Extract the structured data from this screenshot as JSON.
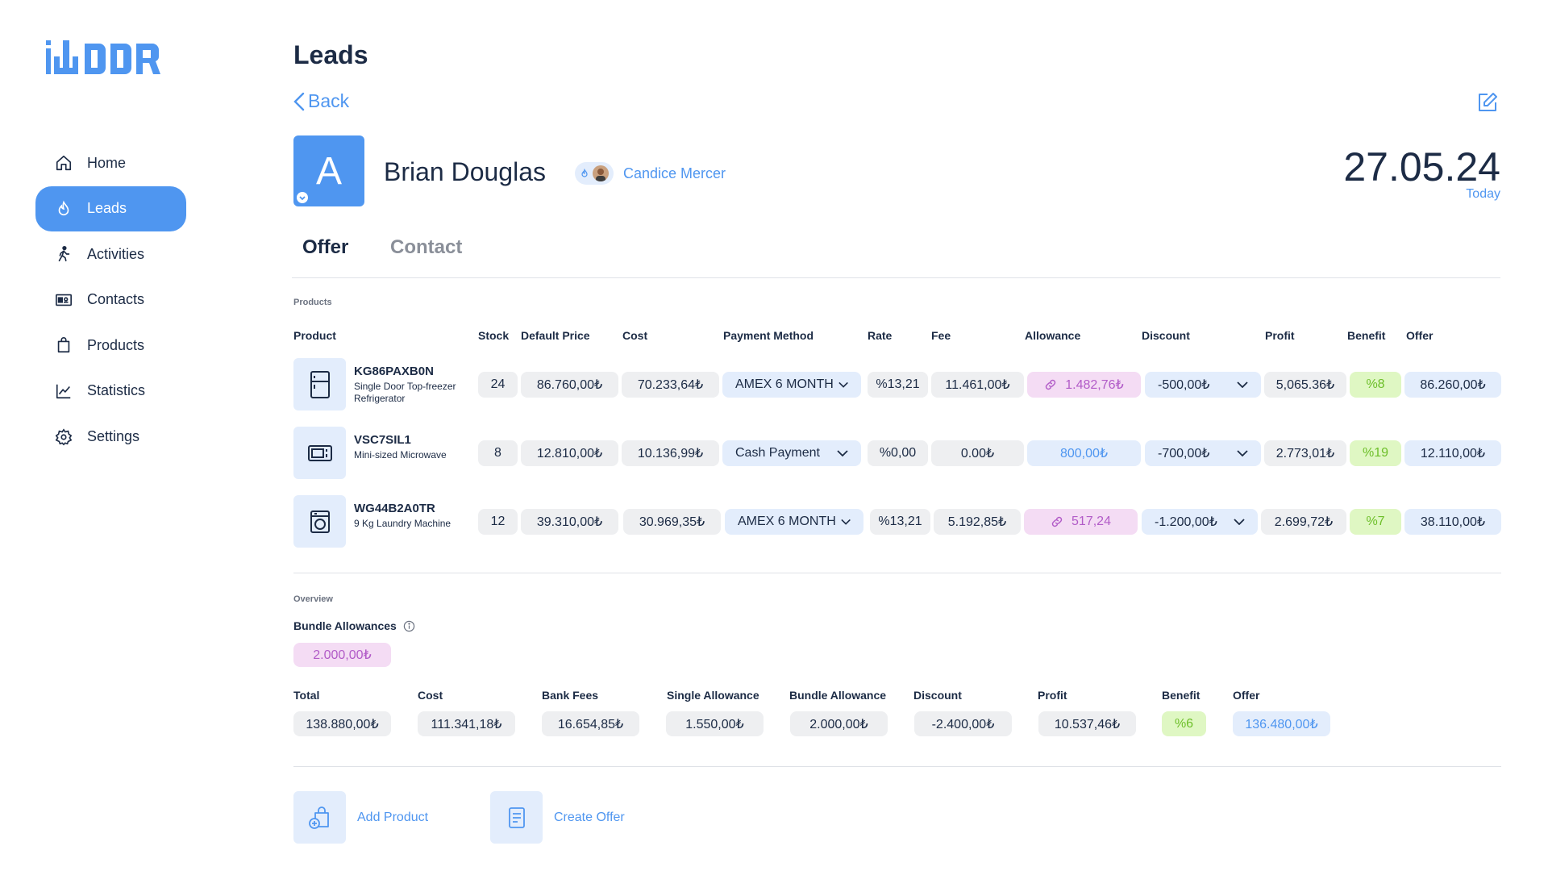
{
  "brand": {
    "logo_text": "iWDDR",
    "accent": "#4f96f0"
  },
  "sidebar": {
    "items": [
      {
        "label": "Home",
        "icon": "home-icon",
        "active": false
      },
      {
        "label": "Leads",
        "icon": "flame-icon",
        "active": true
      },
      {
        "label": "Activities",
        "icon": "walking-icon",
        "active": false
      },
      {
        "label": "Contacts",
        "icon": "contact-card-icon",
        "active": false
      },
      {
        "label": "Products",
        "icon": "bag-icon",
        "active": false
      },
      {
        "label": "Statistics",
        "icon": "chart-line-icon",
        "active": false
      },
      {
        "label": "Settings",
        "icon": "gear-icon",
        "active": false
      }
    ]
  },
  "header": {
    "title": "Leads",
    "back_label": "Back",
    "lead": {
      "initial": "A",
      "name": "Brian Douglas",
      "owner": "Candice Mercer"
    },
    "date": "27.05.24",
    "date_sub": "Today"
  },
  "tabs": [
    {
      "label": "Offer",
      "active": true
    },
    {
      "label": "Contact",
      "active": false
    }
  ],
  "products": {
    "section_label": "Products",
    "columns": [
      "Product",
      "Stock",
      "Default Price",
      "Cost",
      "Payment Method",
      "Rate",
      "Fee",
      "Allowance",
      "Discount",
      "Profit",
      "Benefit",
      "Offer"
    ],
    "rows": [
      {
        "icon": "fridge-icon",
        "code": "KG86PAXB0N",
        "desc": "Single Door Top-freezer Refrigerator",
        "stock": "24",
        "default_price": "86.760,00₺",
        "cost": "70.233,64₺",
        "payment": "AMEX 6 MONTH",
        "rate": "%13,21",
        "fee": "11.461,00₺",
        "allowance": "1.482,76₺",
        "allowance_type": "linked",
        "discount": "-500,00₺",
        "profit": "5,065.36₺",
        "benefit": "%8",
        "offer": "86.260,00₺"
      },
      {
        "icon": "microwave-icon",
        "code": "VSC7SIL1",
        "desc": "Mini-sized Microwave",
        "stock": "8",
        "default_price": "12.810,00₺",
        "cost": "10.136,99₺",
        "payment": "Cash Payment",
        "rate": "%0,00",
        "fee": "0.00₺",
        "allowance": "800,00₺",
        "allowance_type": "plain",
        "discount": "-700,00₺",
        "profit": "2.773,01₺",
        "benefit": "%19",
        "offer": "12.110,00₺"
      },
      {
        "icon": "washing-machine-icon",
        "code": "WG44B2A0TR",
        "desc": "9 Kg Laundry Machine",
        "stock": "12",
        "default_price": "39.310,00₺",
        "cost": "30.969,35₺",
        "payment": "AMEX 6 MONTH",
        "rate": "%13,21",
        "fee": "5.192,85₺",
        "allowance": "517,24",
        "allowance_type": "linked",
        "discount": "-1.200,00₺",
        "profit": "2.699,72₺",
        "benefit": "%7",
        "offer": "38.110,00₺"
      }
    ]
  },
  "overview": {
    "section_label": "Overview",
    "bundle_label": "Bundle Allowances",
    "bundle_value": "2.000,00₺",
    "summary": [
      {
        "label": "Total",
        "value": "138.880,00₺"
      },
      {
        "label": "Cost",
        "value": "111.341,18₺"
      },
      {
        "label": "Bank Fees",
        "value": "16.654,85₺"
      },
      {
        "label": "Single Allowance",
        "value": "1.550,00₺"
      },
      {
        "label": "Bundle Allowance",
        "value": "2.000,00₺"
      },
      {
        "label": "Discount",
        "value": "-2.400,00₺"
      },
      {
        "label": "Profit",
        "value": "10.537,46₺"
      },
      {
        "label": "Benefit",
        "value": "%6"
      },
      {
        "label": "Offer",
        "value": "136.480,00₺"
      }
    ]
  },
  "actions": {
    "add_product": "Add Product",
    "create_offer": "Create Offer"
  }
}
